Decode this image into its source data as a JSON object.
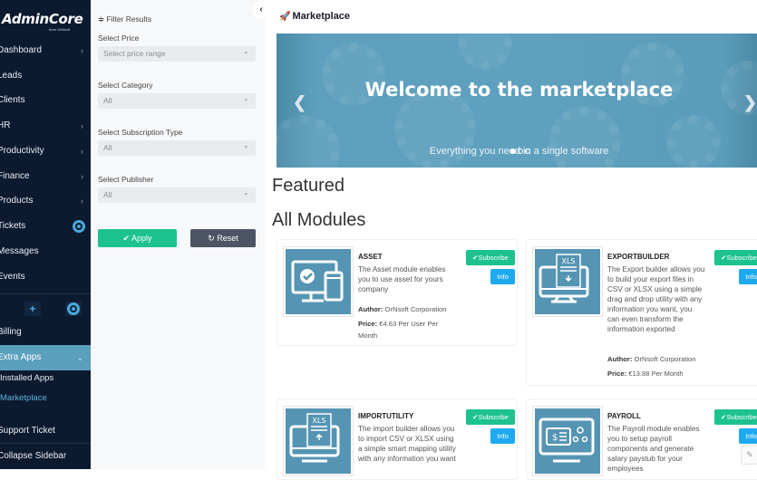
{
  "sidebar": {
    "brand": "AdminCore",
    "brand_sub": "from OrNsoft",
    "items": [
      {
        "label": "Dashboard",
        "chevron": true
      },
      {
        "label": "Leads",
        "chevron": false
      },
      {
        "label": "Clients",
        "chevron": false
      },
      {
        "label": "HR",
        "chevron": true
      },
      {
        "label": "Productivity",
        "chevron": true
      },
      {
        "label": "Finance",
        "chevron": true
      },
      {
        "label": "Products",
        "chevron": true
      },
      {
        "label": "Tickets",
        "chevron": false
      },
      {
        "label": "Messages",
        "chevron": false
      },
      {
        "label": "Events",
        "chevron": false
      }
    ],
    "tools": {
      "add": "+"
    },
    "lower_items": [
      {
        "label": "Billing"
      },
      {
        "label": "Extra Apps"
      },
      {
        "label": "Installed Apps"
      },
      {
        "label": "Marketplace"
      },
      {
        "label": "Support Ticket"
      },
      {
        "label": "Collapse Sidebar"
      }
    ]
  },
  "filter": {
    "title": "Filter Results",
    "price_label": "Select Price",
    "price_value": "Select price range",
    "category_label": "Select Category",
    "category_value": "All",
    "subscription_label": "Select Subscription Type",
    "subscription_value": "All",
    "publisher_label": "Select Publisher",
    "publisher_value": "All",
    "apply": "✔ Apply",
    "reset": "↻ Reset"
  },
  "main": {
    "title": "Marketplace",
    "banner_title": "Welcome to the marketplace",
    "banner_sub": "Everything you need in a single software",
    "carousel_active": 1,
    "carousel_total": 3,
    "featured_heading": "Featured",
    "all_heading": "All Modules",
    "subscribe_label": "✔Subscribe",
    "info_label": "Info",
    "author_label": "Author:",
    "price_label": "Price:",
    "modules": [
      {
        "name": "ASSET",
        "desc": "The Asset module enables you to use asset for yours company",
        "author": "OrNsoft Corporation",
        "price": "€4.63 Per User Per Month",
        "icon": "monitor-check-icon"
      },
      {
        "name": "EXPORTBUILDER",
        "desc": "The Export builder allows you to build your export files in CSV or XLSX using a simple drag and drop utility with any information you want, you can even transform the information exported",
        "author": "OrNsoft Corporation",
        "price": "€13.88 Per Month",
        "icon": "xls-export-icon"
      },
      {
        "name": "IMPORTUTILITY",
        "desc": "The import builder allows you to import CSV or XLSX using a simple smart mapping utility with any information you want",
        "icon": "xls-import-icon"
      },
      {
        "name": "PAYROLL",
        "desc": "The Payroll module enables you to setup payroll components and generate salary paystub for your employees",
        "icon": "payroll-icon"
      }
    ]
  }
}
